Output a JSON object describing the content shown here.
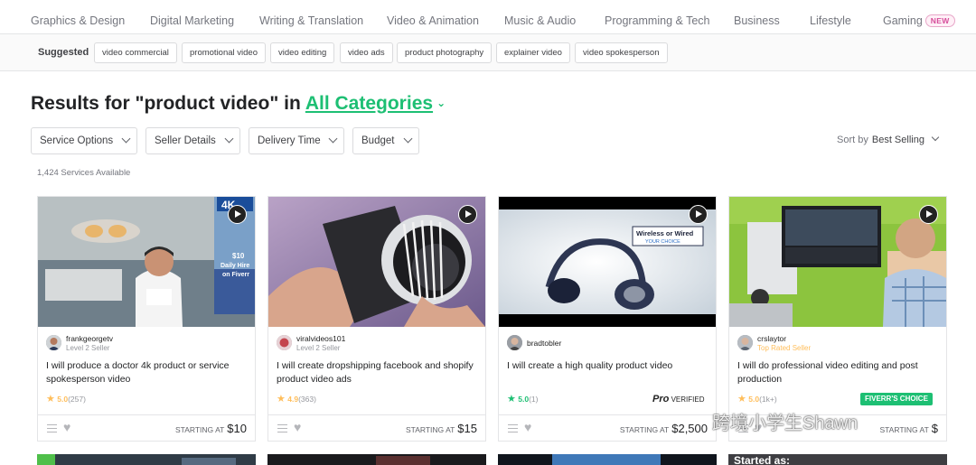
{
  "categories": [
    "Graphics & Design",
    "Digital Marketing",
    "Writing & Translation",
    "Video & Animation",
    "Music & Audio",
    "Programming & Tech",
    "Business",
    "Lifestyle",
    "Gaming"
  ],
  "gaming_badge": "NEW",
  "suggested": {
    "label": "Suggested",
    "chips": [
      "video commercial",
      "promotional video",
      "video editing",
      "video ads",
      "product photography",
      "explainer video",
      "video spokesperson"
    ]
  },
  "results": {
    "prefix": "Results for \"product video\" in",
    "category": "All Categories"
  },
  "filters": [
    "Service Options",
    "Seller Details",
    "Delivery Time",
    "Budget"
  ],
  "sort": {
    "label": "Sort by",
    "value": "Best Selling"
  },
  "count": "1,424 Services Available",
  "cards": [
    {
      "seller": "frankgeorgetv",
      "level": "Level 2 Seller",
      "title": "I will produce a doctor 4k product or service spokesperson video",
      "score": "5.0",
      "reviews": "(257)",
      "starting": "STARTING AT",
      "price": "$10",
      "thumb_text": [
        "4K",
        "$10",
        "Daily Hire",
        "on Fiverr"
      ]
    },
    {
      "seller": "viralvideos101",
      "level": "Level 2 Seller",
      "title": "I will create dropshipping facebook and shopify product video ads",
      "score": "4.9",
      "reviews": "(363)",
      "starting": "STARTING AT",
      "price": "$15"
    },
    {
      "seller": "bradtobler",
      "level": "",
      "title": "I will create a high quality product video",
      "score": "5.0",
      "reviews": "(1)",
      "starting": "STARTING AT",
      "price": "$2,500",
      "pro_word": "Pro",
      "pro_label": "VERIFIED",
      "thumb_text": [
        "Wireless or Wired",
        "YOUR CHOICE"
      ]
    },
    {
      "seller": "crslaytor",
      "level": "Top Rated Seller",
      "title": "I will do professional video editing and post production",
      "score": "5.0",
      "reviews": "(1k+)",
      "starting": "STARTING AT",
      "price": "$",
      "badge": "FIVERR'S CHOICE"
    }
  ],
  "row2_text": "Started as:",
  "watermark": "跨境小学生Shawn",
  "colors": {
    "brand_green": "#1dbf73",
    "star_yellow": "#ffbe5b",
    "new_pink": "#d64e9b"
  }
}
